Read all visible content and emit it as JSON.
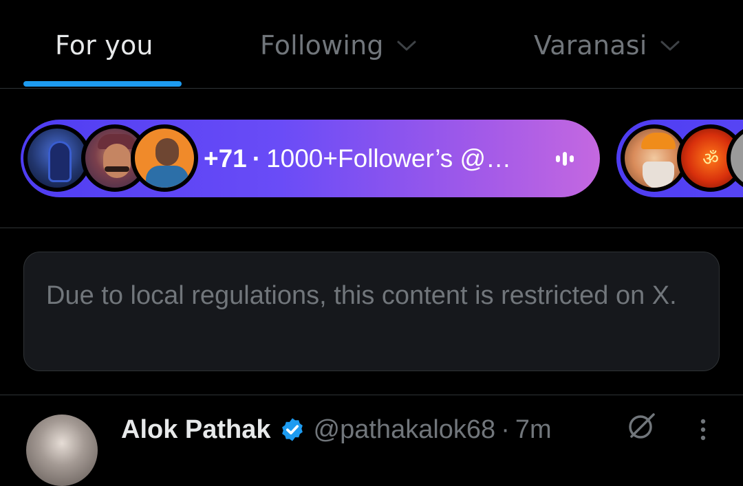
{
  "tabs": [
    {
      "label": "For you",
      "active": true
    },
    {
      "label": "Following",
      "active": false,
      "has_dropdown": true
    },
    {
      "label": "Varanasi",
      "active": false,
      "has_dropdown": true
    }
  ],
  "spaces": [
    {
      "listener_count": "+71",
      "separator": "·",
      "title": "1000+Follower’s @…",
      "icon": "audio-bars-icon",
      "gradient": [
        "#4e3df2",
        "#c468e0"
      ]
    },
    {
      "gradient": [
        "#4e3df2",
        "#5a47f5"
      ]
    }
  ],
  "notice": {
    "text": "Due to local regulations, this content is restricted on X."
  },
  "tweet": {
    "author_name": "Alok Pathak",
    "verified": true,
    "handle": "@pathakalok68",
    "separator": "·",
    "time": "7m",
    "icons": [
      "grok-icon",
      "more-icon"
    ]
  },
  "colors": {
    "background": "#000000",
    "accent": "#1d9bf0",
    "text_primary": "#e7e9ea",
    "text_secondary": "#71767b",
    "divider": "#2f3336",
    "card": "#16181c"
  }
}
